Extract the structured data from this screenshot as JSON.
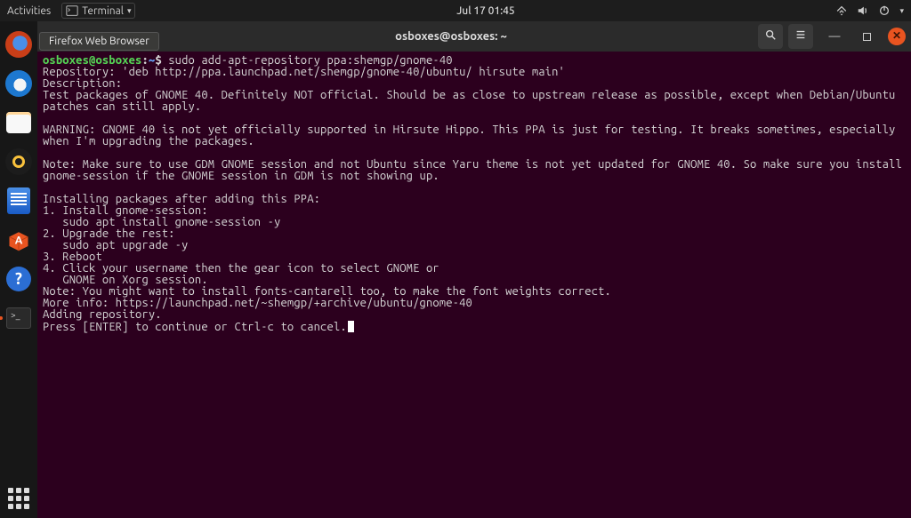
{
  "top_panel": {
    "activities": "Activities",
    "app_menu": "Terminal",
    "datetime": "Jul 17  01:45"
  },
  "tooltip": "Firefox Web Browser",
  "dock": {
    "items": [
      {
        "name": "firefox",
        "label": "Firefox Web Browser"
      },
      {
        "name": "thunderbird",
        "label": "Thunderbird"
      },
      {
        "name": "files",
        "label": "Files"
      },
      {
        "name": "rhythmbox",
        "label": "Rhythmbox"
      },
      {
        "name": "writer",
        "label": "LibreOffice Writer"
      },
      {
        "name": "software",
        "label": "Ubuntu Software"
      },
      {
        "name": "help",
        "label": "Help"
      },
      {
        "name": "terminal",
        "label": "Terminal"
      }
    ]
  },
  "window": {
    "title": "osboxes@osboxes: ~"
  },
  "terminal": {
    "prompt_user_host": "osboxes@osboxes",
    "prompt_path": "~",
    "command": "sudo add-apt-repository ppa:shemgp/gnome-40",
    "lines": [
      "Repository: 'deb http://ppa.launchpad.net/shemgp/gnome-40/ubuntu/ hirsute main'",
      "Description:",
      "Test packages of GNOME 40. Definitely NOT official. Should be as close to upstream release as possible, except when Debian/Ubuntu patches can still apply.",
      "",
      "WARNING: GNOME 40 is not yet officially supported in Hirsute Hippo. This PPA is just for testing. It breaks sometimes, especially when I'm upgrading the packages.",
      "",
      "Note: Make sure to use GDM GNOME session and not Ubuntu since Yaru theme is not yet updated for GNOME 40. So make sure you install gnome-session if the GNOME session in GDM is not showing up.",
      "",
      "Installing packages after adding this PPA:",
      "1. Install gnome-session:",
      "   sudo apt install gnome-session -y",
      "2. Upgrade the rest:",
      "   sudo apt upgrade -y",
      "3. Reboot",
      "4. Click your username then the gear icon to select GNOME or",
      "   GNOME on Xorg session.",
      "Note: You might want to install fonts-cantarell too, to make the font weights correct.",
      "More info: https://launchpad.net/~shemgp/+archive/ubuntu/gnome-40",
      "Adding repository.",
      "Press [ENTER] to continue or Ctrl-c to cancel."
    ]
  }
}
